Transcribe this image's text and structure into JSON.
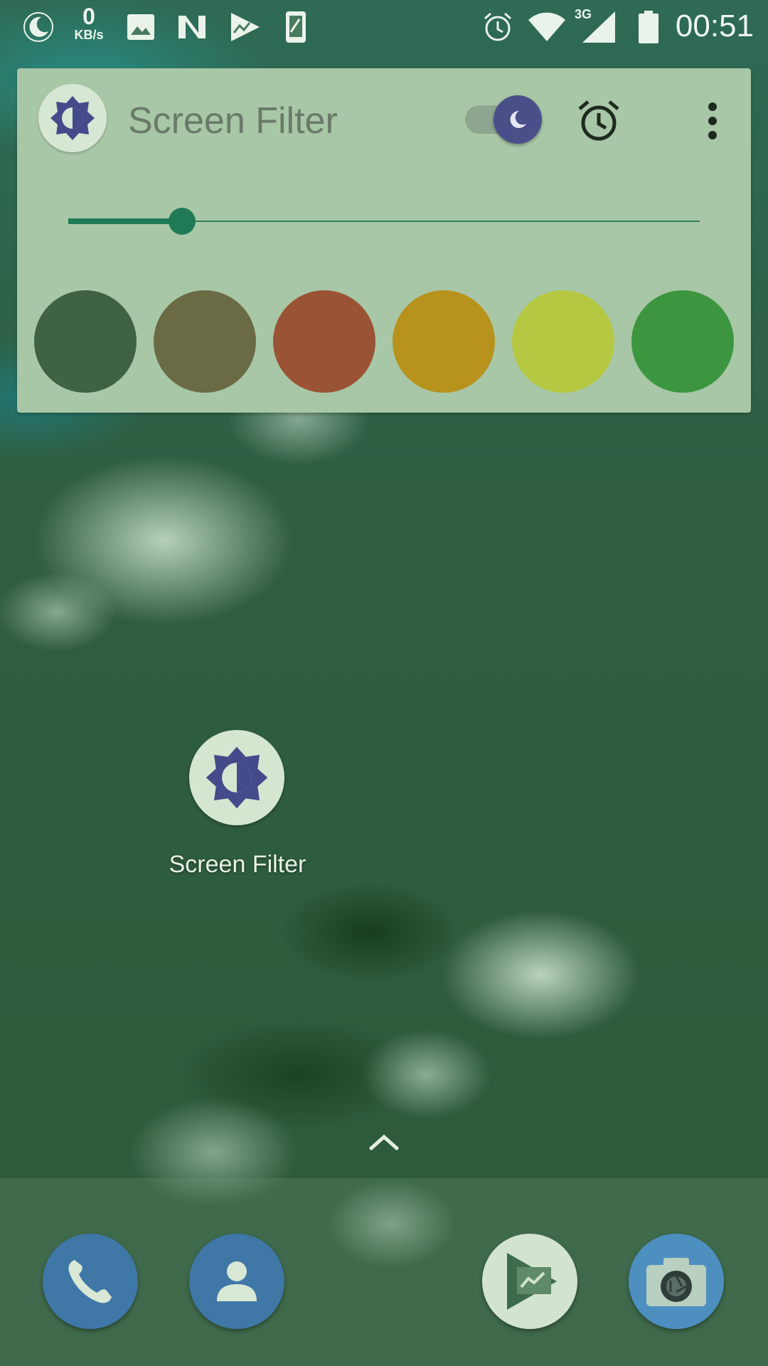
{
  "status_bar": {
    "left_icons": [
      "night-mode-icon",
      "image-icon",
      "n-icon",
      "chart-app-icon",
      "phone-device-icon"
    ],
    "speed_value": "0",
    "speed_unit": "KB/s",
    "right_icons": [
      "alarm-icon",
      "wifi-icon",
      "signal-icon",
      "battery-icon"
    ],
    "network_type": "3G",
    "time": "00:51"
  },
  "widget": {
    "app_icon": "brightness-icon",
    "title": "Screen Filter",
    "toggle": {
      "state": "on",
      "icon": "moon-icon"
    },
    "alarm_icon": "alarm-clock-icon",
    "menu_icon": "more-vert-icon",
    "slider": {
      "value": 0.18
    },
    "swatches": [
      {
        "name": "dark-green",
        "color": "#3f6245"
      },
      {
        "name": "olive",
        "color": "#6a6a45"
      },
      {
        "name": "rust",
        "color": "#9a5334"
      },
      {
        "name": "amber",
        "color": "#b7921c"
      },
      {
        "name": "lime",
        "color": "#b6c842"
      },
      {
        "name": "green",
        "color": "#3c9640"
      }
    ]
  },
  "desktop": {
    "shortcut_label": "Screen Filter",
    "shortcut_icon": "brightness-icon"
  },
  "app_drawer_icon": "chevron-up-icon",
  "dock": {
    "apps": [
      {
        "name": "phone",
        "icon": "phone-icon",
        "bg": "#3f77a6"
      },
      {
        "name": "contacts",
        "icon": "person-icon",
        "bg": "#3f77a6"
      },
      {
        "name": "play-movies",
        "icon": "play-movies-icon",
        "bg": "#d2e3cf"
      },
      {
        "name": "camera",
        "icon": "camera-icon",
        "bg": "#4d8fbf"
      }
    ]
  },
  "colors": {
    "accent": "#1f7a55",
    "toggle": "#4a4f8a",
    "widget_bg": "#a8c7a6"
  }
}
